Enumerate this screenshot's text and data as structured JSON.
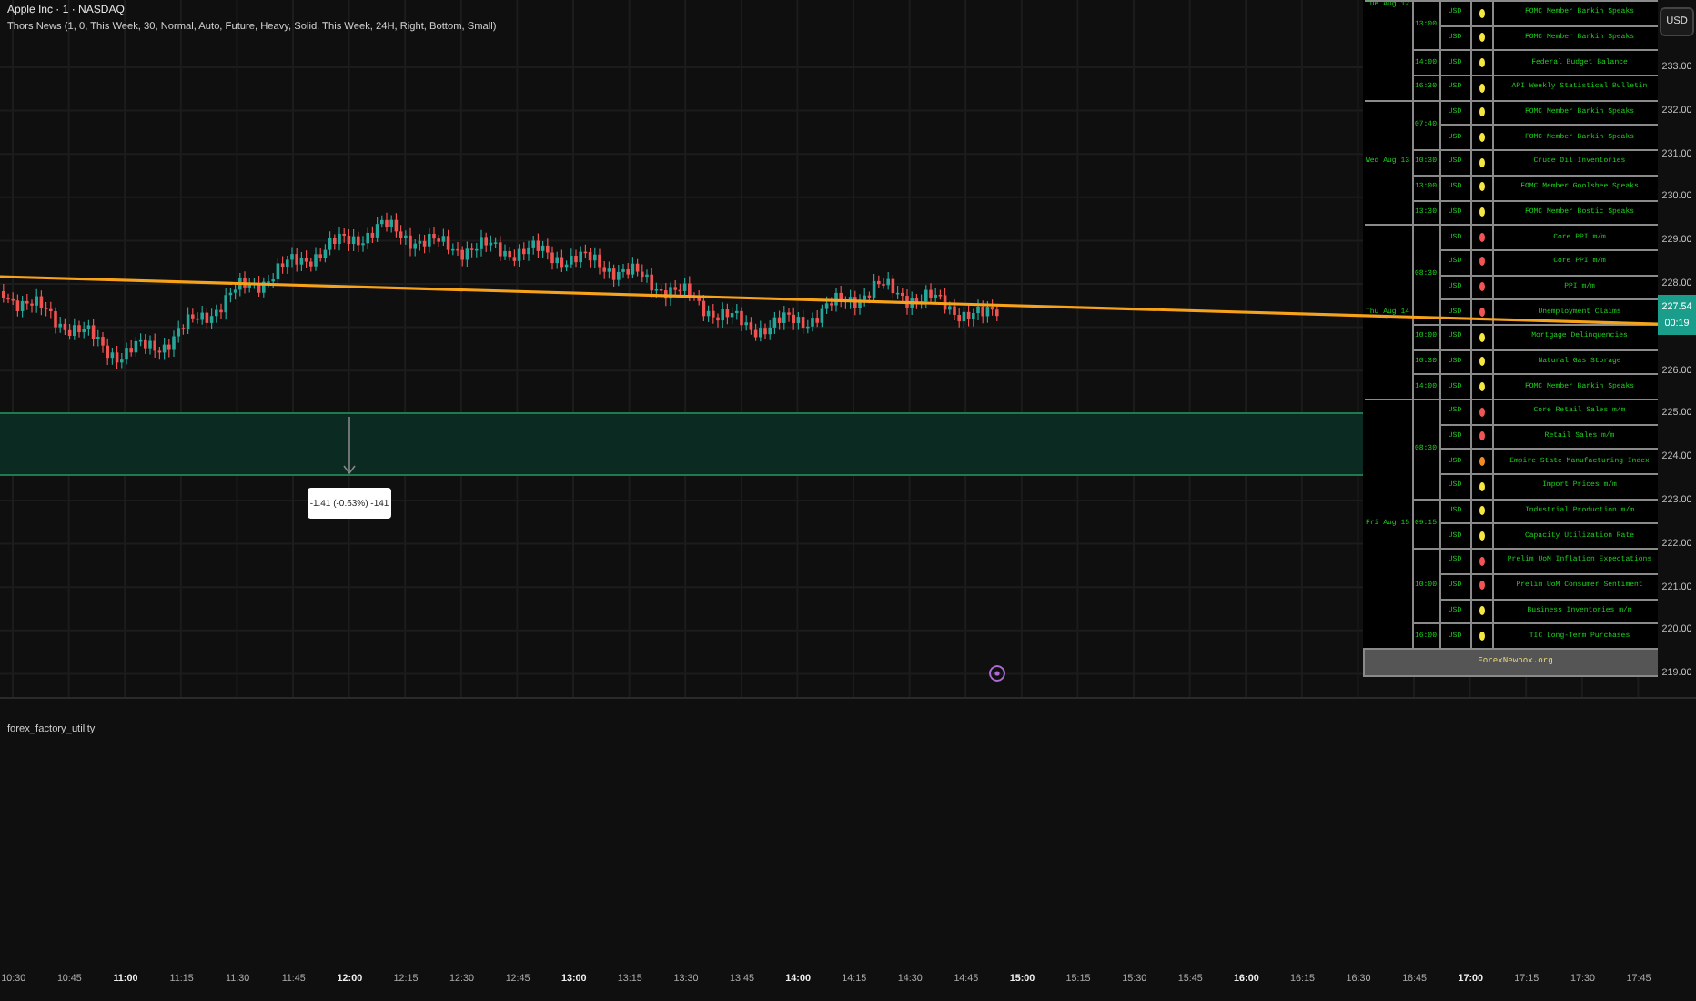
{
  "header": {
    "symbol": "Apple Inc · 1 · NASDAQ",
    "indicator": "Thors News (1, 0, This Week, 30, Normal, Auto, Future, Heavy, Solid, This Week, 24H, Right, Bottom, Small)"
  },
  "measure": {
    "label": "-1.41 (-0.63%) -141"
  },
  "news_table": {
    "days": [
      {
        "date": "Tue Aug 12",
        "slots": [
          {
            "time": "13:00",
            "events": [
              {
                "currency": "USD",
                "color": "#f5e642",
                "title": "FOMC Member Barkin Speaks"
              },
              {
                "currency": "USD",
                "color": "#f5e642",
                "title": "FOMC Member Barkin Speaks"
              }
            ]
          },
          {
            "time": "14:00",
            "events": [
              {
                "currency": "USD",
                "color": "#f5e642",
                "title": "Federal Budget Balance"
              }
            ]
          },
          {
            "time": "16:30",
            "events": [
              {
                "currency": "USD",
                "color": "#f5e642",
                "title": "API Weekly Statistical Bulletin"
              }
            ]
          }
        ]
      },
      {
        "date": "Wed Aug 13",
        "slots": [
          {
            "time": "07:40",
            "events": [
              {
                "currency": "USD",
                "color": "#f5e642",
                "title": "FOMC Member Barkin Speaks"
              },
              {
                "currency": "USD",
                "color": "#f5e642",
                "title": "FOMC Member Barkin Speaks"
              }
            ]
          },
          {
            "time": "10:30",
            "events": [
              {
                "currency": "USD",
                "color": "#f5e642",
                "title": "Crude Oil Inventories"
              }
            ]
          },
          {
            "time": "13:00",
            "events": [
              {
                "currency": "USD",
                "color": "#f5e642",
                "title": "FOMC Member Goolsbee Speaks"
              }
            ]
          },
          {
            "time": "13:30",
            "events": [
              {
                "currency": "USD",
                "color": "#f5e642",
                "title": "FOMC Member Bostic Speaks"
              }
            ]
          }
        ]
      },
      {
        "date": "Thu Aug 14",
        "slots": [
          {
            "time": "08:30",
            "events": [
              {
                "currency": "USD",
                "color": "#f05454",
                "title": "Core PPI m/m"
              },
              {
                "currency": "USD",
                "color": "#f05454",
                "title": "Core PPI m/m"
              },
              {
                "currency": "USD",
                "color": "#f05454",
                "title": "PPI m/m"
              },
              {
                "currency": "USD",
                "color": "#f05454",
                "title": "Unemployment Claims"
              }
            ]
          },
          {
            "time": "10:00",
            "events": [
              {
                "currency": "USD",
                "color": "#f5e642",
                "title": "Mortgage Delinquencies"
              }
            ]
          },
          {
            "time": "10:30",
            "events": [
              {
                "currency": "USD",
                "color": "#f5e642",
                "title": "Natural Gas Storage"
              }
            ]
          },
          {
            "time": "14:00",
            "events": [
              {
                "currency": "USD",
                "color": "#f5e642",
                "title": "FOMC Member Barkin Speaks"
              }
            ]
          }
        ]
      },
      {
        "date": "Fri Aug 15",
        "slots": [
          {
            "time": "08:30",
            "events": [
              {
                "currency": "USD",
                "color": "#f05454",
                "title": "Core Retail Sales m/m"
              },
              {
                "currency": "USD",
                "color": "#f05454",
                "title": "Retail Sales m/m"
              },
              {
                "currency": "USD",
                "color": "#f08a24",
                "title": "Empire State Manufacturing Index"
              },
              {
                "currency": "USD",
                "color": "#f5e642",
                "title": "Import Prices m/m"
              }
            ]
          },
          {
            "time": "09:15",
            "events": [
              {
                "currency": "USD",
                "color": "#f5e642",
                "title": "Industrial Production m/m"
              },
              {
                "currency": "USD",
                "color": "#f5e642",
                "title": "Capacity Utilization Rate"
              }
            ]
          },
          {
            "time": "10:00",
            "events": [
              {
                "currency": "USD",
                "color": "#f05454",
                "title": "Prelim UoM Inflation Expectations"
              },
              {
                "currency": "USD",
                "color": "#f05454",
                "title": "Prelim UoM Consumer Sentiment"
              },
              {
                "currency": "USD",
                "color": "#f5e642",
                "title": "Business Inventories m/m"
              }
            ]
          },
          {
            "time": "16:00",
            "events": [
              {
                "currency": "USD",
                "color": "#f5e642",
                "title": "TIC Long-Term Purchases"
              }
            ]
          }
        ]
      }
    ],
    "footer": "ForexNewbox.org"
  },
  "price_axis": {
    "currency": "USD",
    "ticks": [
      "233.00",
      "232.00",
      "231.00",
      "230.00",
      "229.00",
      "228.00",
      "226.00",
      "225.00",
      "224.00",
      "223.00",
      "222.00",
      "221.00",
      "220.00",
      "219.00"
    ],
    "current_price": "227.54",
    "countdown": "00:19"
  },
  "lower_pane": {
    "title": "forex_factory_utility"
  },
  "time_axis": [
    {
      "label": "10:30",
      "major": false
    },
    {
      "label": "10:45",
      "major": false
    },
    {
      "label": "11:00",
      "major": true
    },
    {
      "label": "11:15",
      "major": false
    },
    {
      "label": "11:30",
      "major": false
    },
    {
      "label": "11:45",
      "major": false
    },
    {
      "label": "12:00",
      "major": true
    },
    {
      "label": "12:15",
      "major": false
    },
    {
      "label": "12:30",
      "major": false
    },
    {
      "label": "12:45",
      "major": false
    },
    {
      "label": "13:00",
      "major": true
    },
    {
      "label": "13:15",
      "major": false
    },
    {
      "label": "13:30",
      "major": false
    },
    {
      "label": "13:45",
      "major": false
    },
    {
      "label": "14:00",
      "major": true
    },
    {
      "label": "14:15",
      "major": false
    },
    {
      "label": "14:30",
      "major": false
    },
    {
      "label": "14:45",
      "major": false
    },
    {
      "label": "15:00",
      "major": true
    },
    {
      "label": "15:15",
      "major": false
    },
    {
      "label": "15:30",
      "major": false
    },
    {
      "label": "15:45",
      "major": false
    },
    {
      "label": "16:00",
      "major": true
    },
    {
      "label": "16:15",
      "major": false
    },
    {
      "label": "16:30",
      "major": false
    },
    {
      "label": "16:45",
      "major": false
    },
    {
      "label": "17:00",
      "major": true
    },
    {
      "label": "17:15",
      "major": false
    },
    {
      "label": "17:30",
      "major": false
    },
    {
      "label": "17:45",
      "major": false
    }
  ]
}
